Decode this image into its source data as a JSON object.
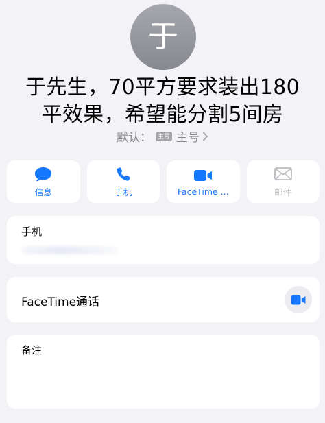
{
  "contact": {
    "avatar_initial": "于",
    "name_line1": "于先生，70平方要求装出180",
    "name_line2": "平效果，希望能分割5间房",
    "default_label": "默认：",
    "sim_badge": "主号",
    "default_value": "主号"
  },
  "actions": [
    {
      "label": "信息",
      "icon": "message-icon",
      "enabled": true
    },
    {
      "label": "手机",
      "icon": "phone-icon",
      "enabled": true
    },
    {
      "label": "FaceTime ...",
      "icon": "video-icon",
      "enabled": true
    },
    {
      "label": "邮件",
      "icon": "mail-icon",
      "enabled": false
    }
  ],
  "phone_card": {
    "label": "手机",
    "value_obscured": true
  },
  "facetime_card": {
    "label": "FaceTime通话",
    "icon": "video-icon"
  },
  "notes_card": {
    "label": "备注"
  },
  "colors": {
    "accent": "#1677ff",
    "background": "#f2f2f7",
    "card": "#ffffff",
    "disabled": "#c3c3c7",
    "secondary_text": "#8a8a8e"
  }
}
